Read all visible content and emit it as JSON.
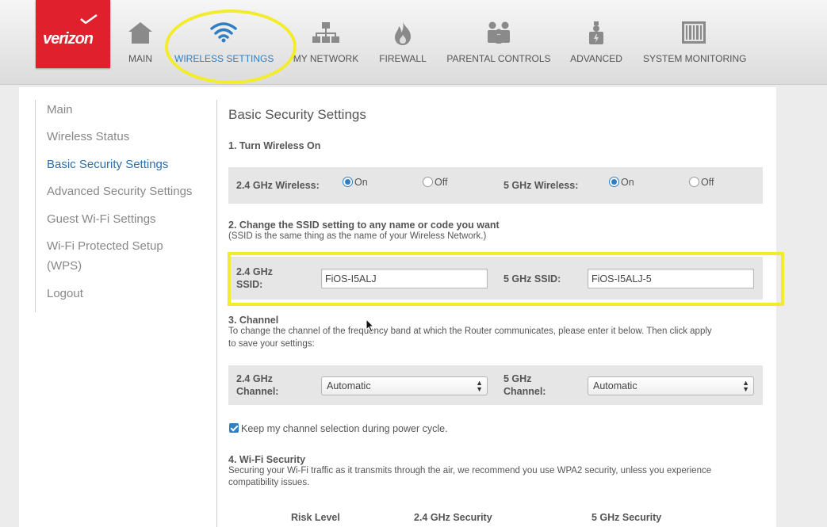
{
  "brand": {
    "name": "verizon",
    "accent": "#e0212d"
  },
  "nav": [
    {
      "label": "MAIN",
      "icon": "home-icon"
    },
    {
      "label": "WIRELESS SETTINGS",
      "icon": "wifi-icon",
      "active": true
    },
    {
      "label": "MY NETWORK",
      "icon": "network-icon"
    },
    {
      "label": "FIREWALL",
      "icon": "flame-icon"
    },
    {
      "label": "PARENTAL CONTROLS",
      "icon": "people-icon"
    },
    {
      "label": "ADVANCED",
      "icon": "advanced-icon"
    },
    {
      "label": "SYSTEM MONITORING",
      "icon": "monitor-icon"
    }
  ],
  "sidebar": [
    {
      "label": "Main"
    },
    {
      "label": "Wireless Status"
    },
    {
      "label": "Basic Security Settings",
      "active": true
    },
    {
      "label": "Advanced Security Settings"
    },
    {
      "label": "Guest Wi-Fi Settings"
    },
    {
      "label": "Wi-Fi Protected Setup"
    },
    {
      "label": "(WPS)"
    },
    {
      "label": "Logout"
    }
  ],
  "page": {
    "title": "Basic Security Settings",
    "s1": {
      "title": "1. Turn Wireless On",
      "label24": "2.4 GHz Wireless:",
      "label5": "5 GHz Wireless:",
      "on": "On",
      "off": "Off",
      "state24": "On",
      "state5": "On"
    },
    "s2": {
      "title": "2. Change the SSID setting to any name or code you want",
      "note": "(SSID is the same thing as the name of your Wireless Network.)",
      "label24_line1": "2.4 GHz",
      "label24_line2": "SSID:",
      "label5": "5 GHz SSID:",
      "ssid24": "FiOS-I5ALJ",
      "ssid5": "FiOS-I5ALJ-5"
    },
    "s3": {
      "title": "3. Channel",
      "note_line1": "To change the channel of the frequency band at which the Router communicates, please enter it below. Then click apply",
      "note_line2": "to save your settings:",
      "label24_line1": "2.4 GHz",
      "label24_line2": "Channel:",
      "label5_line1": "5 GHz",
      "label5_line2": "Channel:",
      "channel24": "Automatic",
      "channel5": "Automatic",
      "keep_label": "Keep my channel selection during power cycle.",
      "keep_checked": true
    },
    "s4": {
      "title": "4. Wi-Fi Security",
      "note_line1": "Securing your Wi-Fi traffic as it transmits through the air, we recommend you use WPA2 security, unless you experience",
      "note_line2": "compatibility issues.",
      "col_risk": "Risk Level",
      "col_24": "2.4 GHz Security",
      "col_5": "5 GHz Security"
    }
  }
}
